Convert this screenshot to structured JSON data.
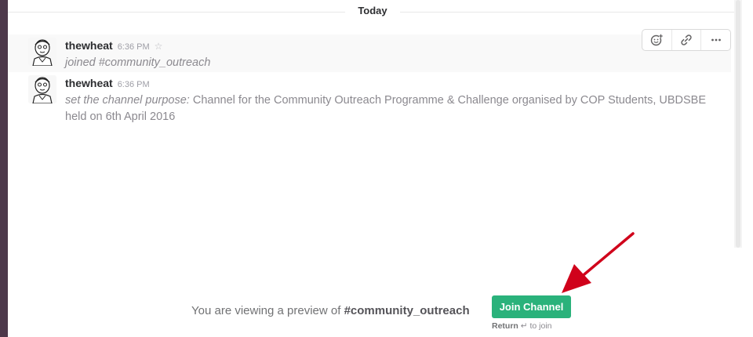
{
  "day_divider": {
    "label": "Today"
  },
  "messages": [
    {
      "sender": "thewheat",
      "time": "6:36 PM",
      "text": "joined #community_outreach"
    },
    {
      "sender": "thewheat",
      "time": "6:36 PM",
      "purpose_label": "set the channel purpose:",
      "text": "Channel for the Community Outreach Programme & Challenge organised by COP Students, UBDSBE held on 6th April 2016"
    }
  ],
  "message_actions": {
    "icons": [
      "add-reaction-icon",
      "link-icon",
      "more-icon"
    ]
  },
  "preview": {
    "text": "You are viewing a preview of",
    "channel": "#community_outreach",
    "join_label": "Join Channel",
    "hint_key": "Return",
    "hint_symbol": "↵",
    "hint_text": "to join"
  },
  "colors": {
    "join_button": "#2ab27b",
    "sidebar": "#4d394b",
    "annotation_arrow": "#d0021b"
  }
}
